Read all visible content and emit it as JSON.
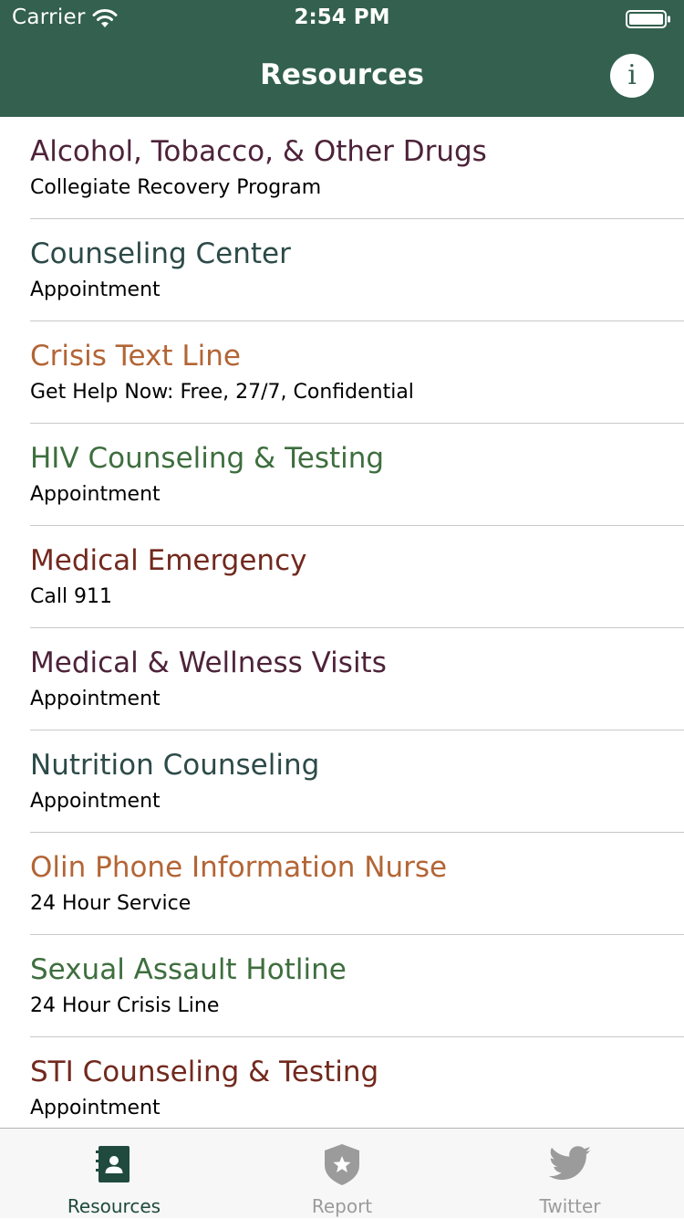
{
  "status_bar": {
    "carrier": "Carrier",
    "time": "2:54 PM"
  },
  "nav": {
    "title": "Resources",
    "info_icon_glyph": "i",
    "color": "#33604f"
  },
  "items": [
    {
      "title": "Alcohol, Tobacco, & Other Drugs",
      "subtitle": "Collegiate Recovery Program",
      "color": "#4d2339"
    },
    {
      "title": "Counseling Center",
      "subtitle": "Appointment",
      "color": "#2c4a48"
    },
    {
      "title": "Crisis Text Line",
      "subtitle": "Get Help Now: Free, 27/7, Confidential",
      "color": "#b36535"
    },
    {
      "title": "HIV Counseling & Testing",
      "subtitle": "Appointment",
      "color": "#3e6e3e"
    },
    {
      "title": "Medical Emergency",
      "subtitle": "Call 911",
      "color": "#72291e"
    },
    {
      "title": "Medical & Wellness Visits",
      "subtitle": "Appointment",
      "color": "#4d2339"
    },
    {
      "title": "Nutrition Counseling",
      "subtitle": "Appointment",
      "color": "#2c4a48"
    },
    {
      "title": "Olin Phone Information Nurse",
      "subtitle": "24 Hour Service",
      "color": "#b36535"
    },
    {
      "title": "Sexual Assault Hotline",
      "subtitle": "24 Hour Crisis Line",
      "color": "#3e6e3e"
    },
    {
      "title": "STI Counseling & Testing",
      "subtitle": "Appointment",
      "color": "#72291e"
    }
  ],
  "tabs": [
    {
      "label": "Resources",
      "icon": "contact-book-icon",
      "active": true
    },
    {
      "label": "Report",
      "icon": "badge-star-icon",
      "active": false
    },
    {
      "label": "Twitter",
      "icon": "twitter-bird-icon",
      "active": false
    }
  ],
  "colors": {
    "tab_active": "#1f4a3d",
    "tab_inactive": "#9b9b9b"
  }
}
